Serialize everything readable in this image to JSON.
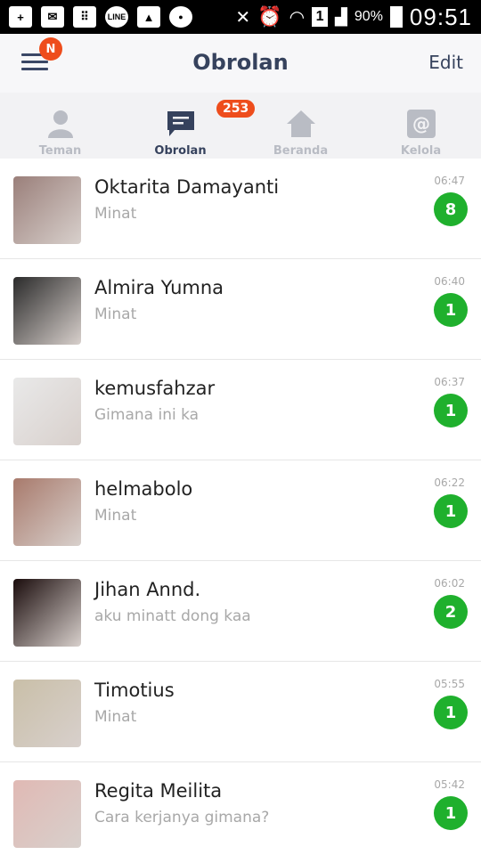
{
  "status_bar": {
    "battery": "90%",
    "time": "09:51",
    "sim": "1",
    "line_app": "LINE"
  },
  "header": {
    "title": "Obrolan",
    "edit_label": "Edit",
    "notification_badge": "N"
  },
  "tabs": [
    {
      "label": "Teman",
      "icon": "person-icon",
      "active": false
    },
    {
      "label": "Obrolan",
      "icon": "chat-icon",
      "active": true,
      "badge": "253"
    },
    {
      "label": "Beranda",
      "icon": "home-icon",
      "active": false
    },
    {
      "label": "Kelola",
      "icon": "at-icon",
      "active": false
    }
  ],
  "chats": [
    {
      "name": "Oktarita Damayanti",
      "message": "Minat",
      "time": "06:47",
      "unread": "8",
      "avatar_color": "#9a7f7a"
    },
    {
      "name": "Almira Yumna",
      "message": "Minat",
      "time": "06:40",
      "unread": "1",
      "avatar_color": "#2a2a2a"
    },
    {
      "name": "kemusfahzar",
      "message": "Gimana ini ka",
      "time": "06:37",
      "unread": "1",
      "avatar_color": "#e9e9e9"
    },
    {
      "name": "helmabolo",
      "message": "Minat",
      "time": "06:22",
      "unread": "1",
      "avatar_color": "#a87a6c"
    },
    {
      "name": "Jihan Annd.",
      "message": "aku minatt dong kaa",
      "time": "06:02",
      "unread": "2",
      "avatar_color": "#1a0c0c"
    },
    {
      "name": "Timotius",
      "message": "Minat",
      "time": "05:55",
      "unread": "1",
      "avatar_color": "#c9bfa8"
    },
    {
      "name": "Regita Meilita",
      "message": "Cara kerjanya gimana?",
      "time": "05:42",
      "unread": "1",
      "avatar_color": "#e0b9b4"
    }
  ],
  "colors": {
    "accent": "#36425d",
    "badge_red": "#ee4d1c",
    "unread_green": "#1fb02d"
  }
}
